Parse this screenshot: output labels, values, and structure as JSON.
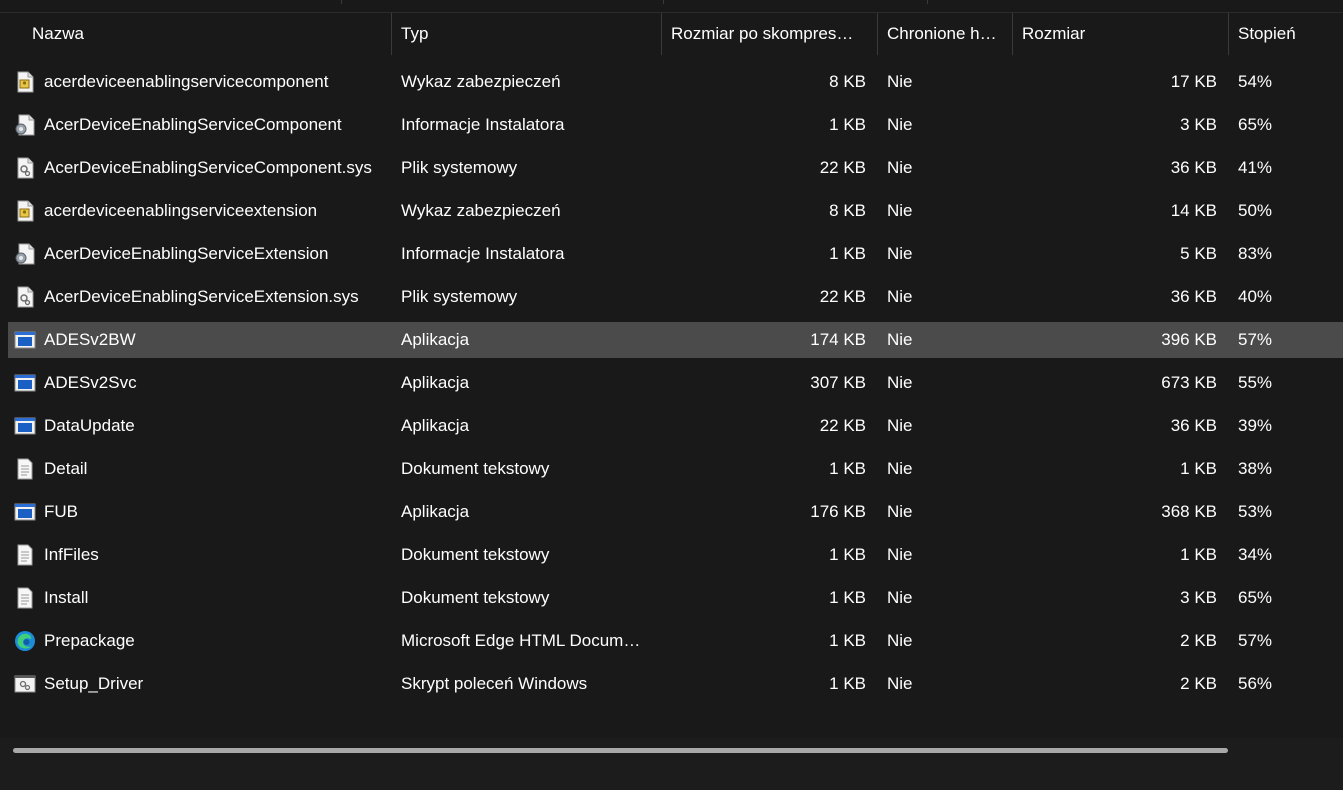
{
  "columns": {
    "name": "Nazwa",
    "type": "Typ",
    "compressed": "Rozmiar po skompres…",
    "protected": "Chronione h…",
    "size": "Rozmiar",
    "ratio": "Stopień"
  },
  "sort_indicator": "^",
  "files": [
    {
      "name": "acerdeviceenablingservicecomponent",
      "type": "Wykaz zabezpieczeń",
      "compressed": "8 KB",
      "protected": "Nie",
      "size": "17 KB",
      "ratio": "54%",
      "icon": "security-catalog-icon"
    },
    {
      "name": "AcerDeviceEnablingServiceComponent",
      "type": "Informacje Instalatora",
      "compressed": "1 KB",
      "protected": "Nie",
      "size": "3 KB",
      "ratio": "65%",
      "icon": "setup-info-icon"
    },
    {
      "name": "AcerDeviceEnablingServiceComponent.sys",
      "type": "Plik systemowy",
      "compressed": "22 KB",
      "protected": "Nie",
      "size": "36 KB",
      "ratio": "41%",
      "icon": "system-file-icon"
    },
    {
      "name": "acerdeviceenablingserviceextension",
      "type": "Wykaz zabezpieczeń",
      "compressed": "8 KB",
      "protected": "Nie",
      "size": "14 KB",
      "ratio": "50%",
      "icon": "security-catalog-icon"
    },
    {
      "name": "AcerDeviceEnablingServiceExtension",
      "type": "Informacje Instalatora",
      "compressed": "1 KB",
      "protected": "Nie",
      "size": "5 KB",
      "ratio": "83%",
      "icon": "setup-info-icon"
    },
    {
      "name": "AcerDeviceEnablingServiceExtension.sys",
      "type": "Plik systemowy",
      "compressed": "22 KB",
      "protected": "Nie",
      "size": "36 KB",
      "ratio": "40%",
      "icon": "system-file-icon"
    },
    {
      "name": "ADESv2BW",
      "type": "Aplikacja",
      "compressed": "174 KB",
      "protected": "Nie",
      "size": "396 KB",
      "ratio": "57%",
      "icon": "application-icon",
      "selected": true
    },
    {
      "name": "ADESv2Svc",
      "type": "Aplikacja",
      "compressed": "307 KB",
      "protected": "Nie",
      "size": "673 KB",
      "ratio": "55%",
      "icon": "application-icon"
    },
    {
      "name": "DataUpdate",
      "type": "Aplikacja",
      "compressed": "22 KB",
      "protected": "Nie",
      "size": "36 KB",
      "ratio": "39%",
      "icon": "application-icon"
    },
    {
      "name": "Detail",
      "type": "Dokument tekstowy",
      "compressed": "1 KB",
      "protected": "Nie",
      "size": "1 KB",
      "ratio": "38%",
      "icon": "text-document-icon"
    },
    {
      "name": "FUB",
      "type": "Aplikacja",
      "compressed": "176 KB",
      "protected": "Nie",
      "size": "368 KB",
      "ratio": "53%",
      "icon": "application-icon"
    },
    {
      "name": "InfFiles",
      "type": "Dokument tekstowy",
      "compressed": "1 KB",
      "protected": "Nie",
      "size": "1 KB",
      "ratio": "34%",
      "icon": "text-document-icon"
    },
    {
      "name": "Install",
      "type": "Dokument tekstowy",
      "compressed": "1 KB",
      "protected": "Nie",
      "size": "3 KB",
      "ratio": "65%",
      "icon": "text-document-icon"
    },
    {
      "name": "Prepackage",
      "type": "Microsoft Edge HTML Docum…",
      "compressed": "1 KB",
      "protected": "Nie",
      "size": "2 KB",
      "ratio": "57%",
      "icon": "edge-html-icon"
    },
    {
      "name": "Setup_Driver",
      "type": "Skrypt poleceń Windows",
      "compressed": "1 KB",
      "protected": "Nie",
      "size": "2 KB",
      "ratio": "56%",
      "icon": "batch-script-icon"
    }
  ],
  "colors": {
    "background": "#191919",
    "selected_row": "#4b4b4b",
    "text": "#ffffff",
    "scrollbar_thumb": "#a8a8a8"
  }
}
